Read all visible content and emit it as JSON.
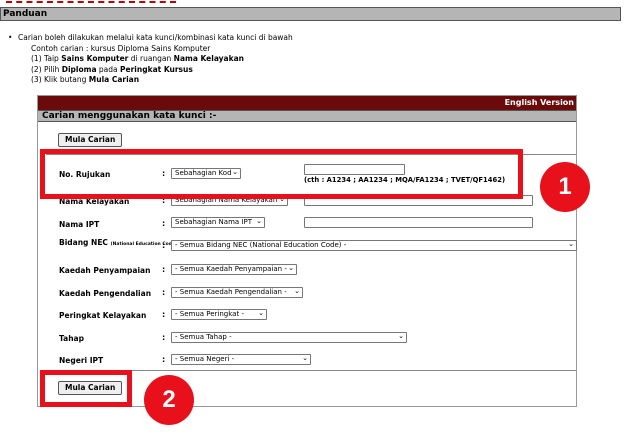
{
  "panduan": {
    "title": "Panduan",
    "bullet": "Carian boleh dilakukan melalui kata kunci/kombinasi kata kunci di bawah",
    "example": "Contoh carian : kursus Diploma Sains Komputer",
    "steps": [
      {
        "pre": "(1) Taip ",
        "b1": "Sains Komputer",
        "mid": " di ruangan ",
        "b2": "Nama Kelayakan"
      },
      {
        "pre": "(2) Pilih ",
        "b1": "Diploma",
        "mid": " pada ",
        "b2": "Peringkat Kursus"
      },
      {
        "pre": "(3) Klik butang ",
        "b1": "Mula Carian",
        "mid": "",
        "b2": ""
      }
    ]
  },
  "form": {
    "english_version": "English Version",
    "header": "Carian menggunakan kata kunci :-",
    "search_button": "Mula Carian",
    "colon": ":",
    "fields": [
      {
        "label": "No. Rujukan",
        "select": "Sebahagian Kod",
        "has_text": true,
        "text_value": ""
      },
      {
        "label": "Nama Kelayakan",
        "select": "Sebahagian Nama Kelayakan",
        "has_text": true,
        "text_value": ""
      },
      {
        "label": "Nama IPT",
        "select": "Sebahagian Nama IPT",
        "has_text": true,
        "text_value": ""
      },
      {
        "label": "Bidang NEC",
        "label_small": "(National Education Code)",
        "select": "- Semua Bidang NEC (National Education Code) -"
      },
      {
        "label": "Kaedah Penyampaian",
        "select": "- Semua Kaedah Penyampaian -"
      },
      {
        "label": "Kaedah Pengendalian",
        "select": "- Semua Kaedah Pengendalian -"
      },
      {
        "label": "Peringkat Kelayakan",
        "select": "- Semua Peringkat -"
      },
      {
        "label": "Tahap",
        "select": "- Semua Tahap -"
      },
      {
        "label": "Negeri IPT",
        "select": "- Semua Negeri -"
      }
    ],
    "rujukan_hint": "(cth : A1234 ; AA1234 ; MQA/FA1234 ; TVET/QF1462)"
  },
  "annotations": {
    "badge_1": "1",
    "badge_2": "2",
    "highlight_color": "#e8101b"
  },
  "icons": {
    "dropdown": "chevron-down-icon"
  }
}
